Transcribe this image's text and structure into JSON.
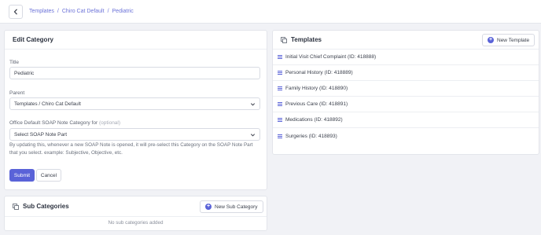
{
  "breadcrumb": [
    "Templates",
    "Chiro Cat Default",
    "Pediatric"
  ],
  "edit_category": {
    "title": "Edit Category",
    "title_label": "Title",
    "title_value": "Pediatric",
    "parent_label": "Parent",
    "parent_value": "Templates / Chiro Cat Default",
    "soap_label": "Office Default SOAP Note Category for",
    "soap_optional": "(optional)",
    "soap_value": "Select SOAP Note Part",
    "help_text": "By updating this, whenever a new SOAP Note is opened, it will pre-select this Category on the SOAP Note Part that you select. example: Subjective, Objective, etc.",
    "submit_label": "Submit",
    "cancel_label": "Cancel"
  },
  "sub_categories": {
    "title": "Sub Categories",
    "new_button": "New Sub Category",
    "empty_text": "No sub categories added"
  },
  "templates": {
    "title": "Templates",
    "new_button": "New Template",
    "items": [
      "Initial Visit Chief Complaint (ID: 418888)",
      "Personal History (ID: 418889)",
      "Family History (ID: 418890)",
      "Previous Care (ID: 418891)",
      "Medications (ID: 418892)",
      "Surgeries (ID: 418893)"
    ]
  },
  "colors": {
    "accent": "#5a63d8",
    "background": "#f1f2f6"
  }
}
